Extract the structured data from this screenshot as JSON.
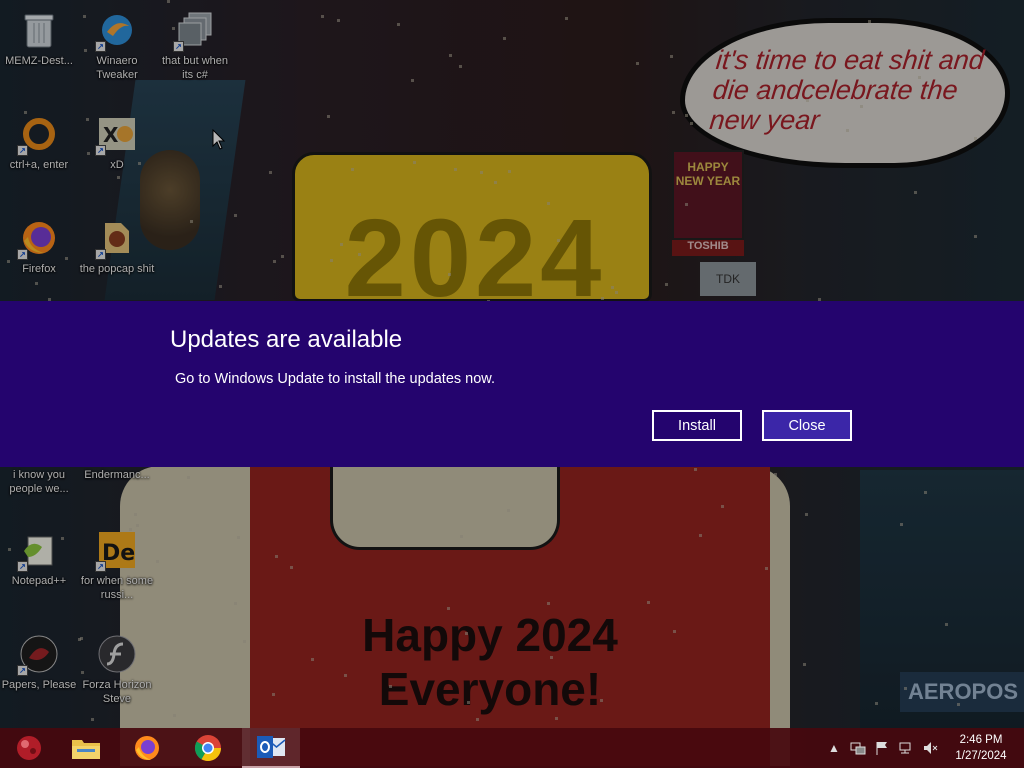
{
  "wallpaper": {
    "bubble_text": "it's time to eat shit and die andcelebrate the new year",
    "hat_text": "2024",
    "shirt_text": "Happy 2024 Everyone!",
    "sign_text": "HAPPY NEW YEAR",
    "sign2_text": "TOSHIB",
    "sign3_text": "TDK",
    "aero_text": "AEROPOS"
  },
  "desktop_icons": [
    {
      "label": "MEMZ-Dest...",
      "icon": "recycle-bin-icon"
    },
    {
      "label": "Winaero Tweaker",
      "icon": "winaero-icon"
    },
    {
      "label": "that but when its c#",
      "icon": "stacked-windows-icon"
    },
    {
      "label": "ctrl+a, enter",
      "icon": "ring-icon"
    },
    {
      "label": "xD",
      "icon": "xd-icon"
    },
    {
      "label": "Firefox",
      "icon": "firefox-icon"
    },
    {
      "label": "the popcap shit",
      "icon": "popcap-icon"
    },
    {
      "label": "i know you people we...",
      "icon": "partial-icon"
    },
    {
      "label": "Endermanc...",
      "icon": "partial-icon"
    },
    {
      "label": "Notepad++",
      "icon": "notepadpp-icon"
    },
    {
      "label": "for when some russi...",
      "icon": "de-icon"
    },
    {
      "label": "Papers, Please",
      "icon": "papers-please-icon"
    },
    {
      "label": "Forza Horizon Steve",
      "icon": "flash-icon"
    }
  ],
  "banner": {
    "title": "Updates are available",
    "description": "Go to Windows Update to install the updates now.",
    "install_label": "Install",
    "close_label": "Close",
    "background": "#24046e"
  },
  "taskbar": {
    "apps": [
      "start-orb-icon",
      "file-explorer-icon",
      "firefox-icon",
      "chrome-icon",
      "outlook-icon"
    ],
    "active_app": "outlook-icon",
    "time": "2:46 PM",
    "date": "1/27/2024"
  }
}
